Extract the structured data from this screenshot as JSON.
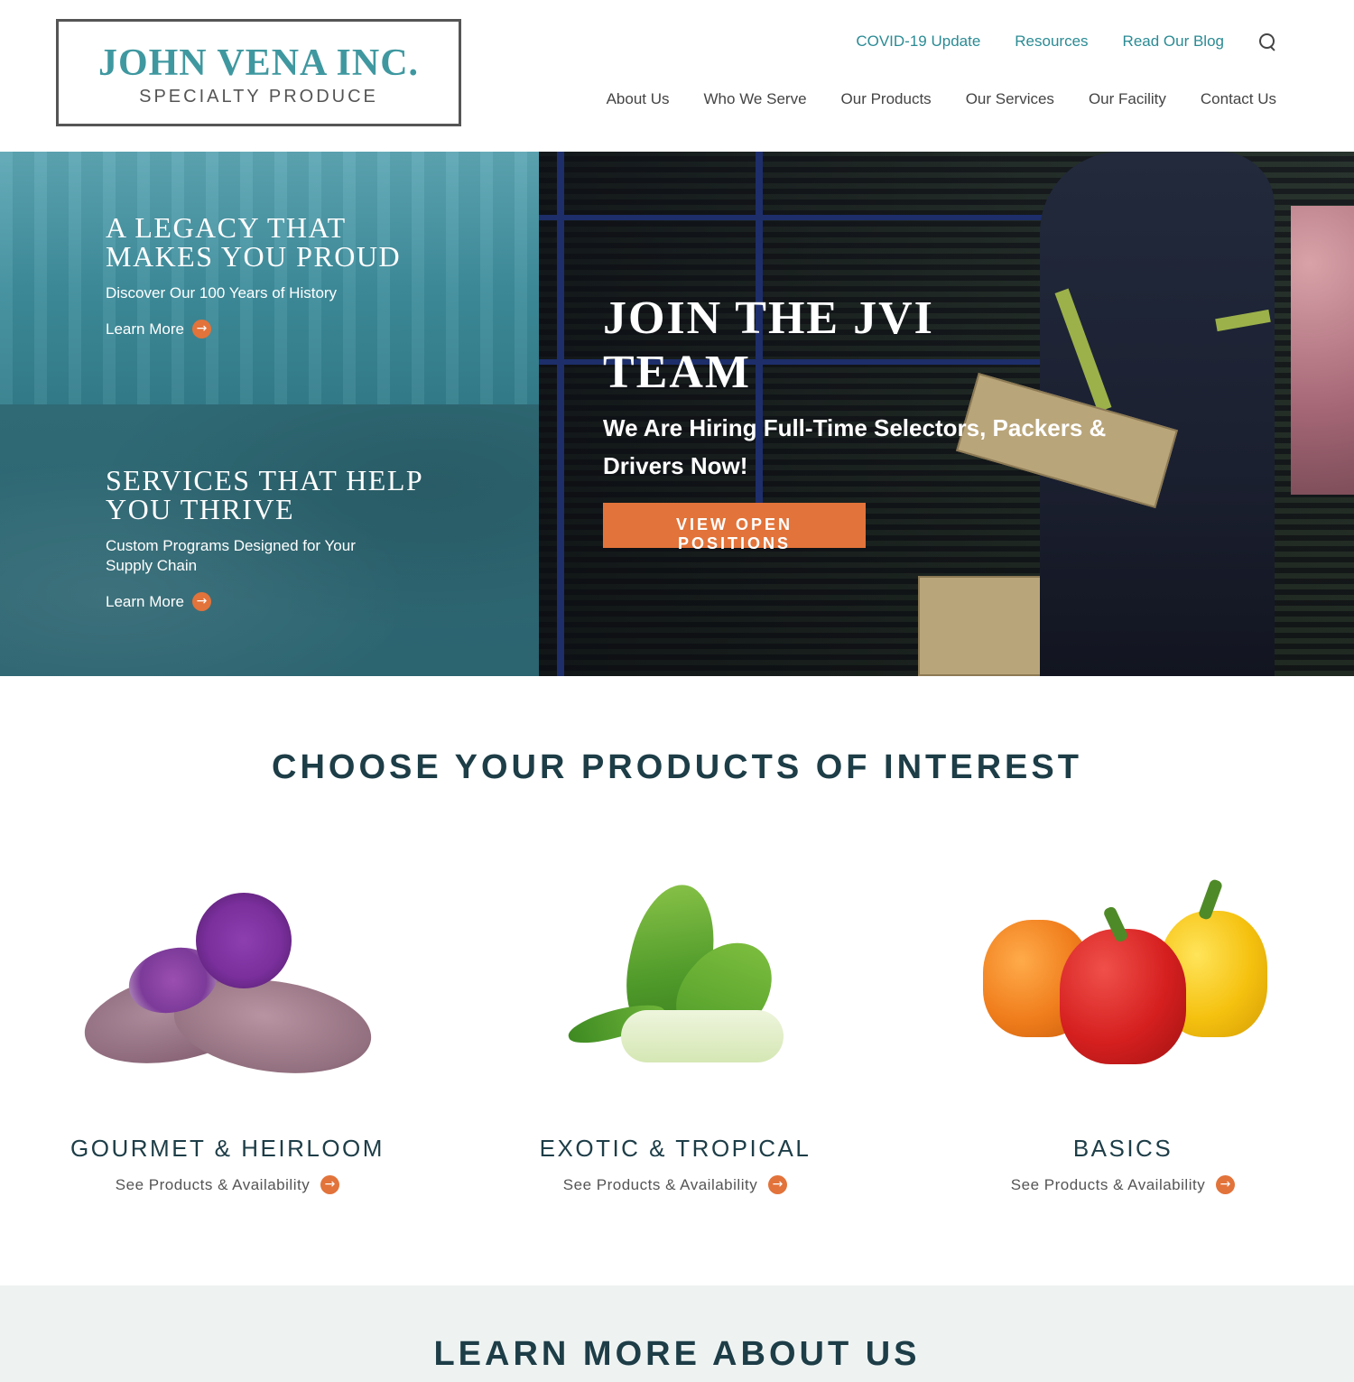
{
  "header": {
    "logo_name": "JOHN VENA INC.",
    "logo_sub": "SPECIALTY PRODUCE",
    "utility_nav": [
      "COVID-19 Update",
      "Resources",
      "Read Our Blog"
    ],
    "main_nav": [
      "About Us",
      "Who We Serve",
      "Our Products",
      "Our Services",
      "Our Facility",
      "Contact Us"
    ]
  },
  "hero": {
    "legacy": {
      "title": "A Legacy That Makes You Proud",
      "subtitle": "Discover Our 100 Years of History",
      "link": "Learn More"
    },
    "services": {
      "title": "Services That Help You Thrive",
      "subtitle": "Custom Programs Designed for Your Supply Chain",
      "link": "Learn More"
    },
    "jobs": {
      "title": "Join the JVI Team",
      "subtitle": "We Are Hiring Full-Time Selectors, Packers & Drivers Now!",
      "cta": "View Open Positions"
    }
  },
  "products": {
    "title": "Choose Your Products of Interest",
    "items": [
      {
        "name": "Gourmet & Heirloom",
        "link": "See Products & Availability"
      },
      {
        "name": "Exotic & Tropical",
        "link": "See Products & Availability"
      },
      {
        "name": "Basics",
        "link": "See Products & Availability"
      }
    ]
  },
  "learn": {
    "title": "Learn More About Us"
  },
  "icons": {
    "arrow": "→"
  },
  "colors": {
    "teal": "#2b8b94",
    "navy": "#1d3d47",
    "orange": "#e2733a"
  }
}
